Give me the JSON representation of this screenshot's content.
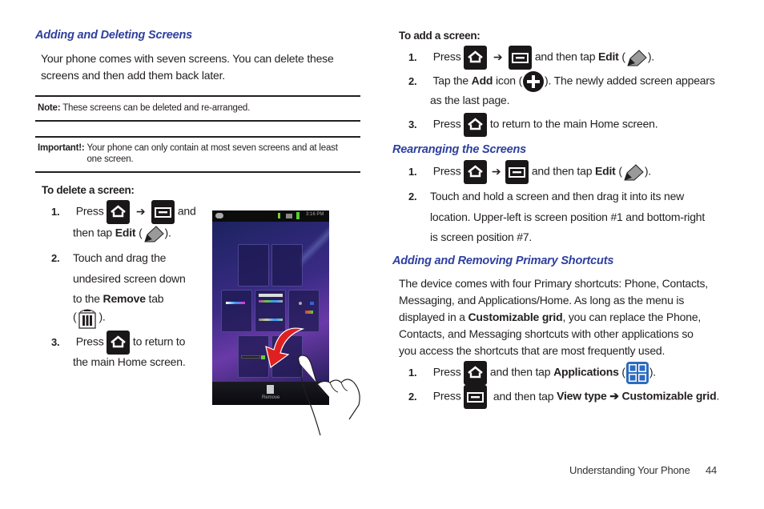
{
  "left_column": {
    "section_title": "Adding and Deleting Screens",
    "intro_lines": [
      "Your phone comes with seven screens. You can delete these",
      "screens and then add them back later."
    ],
    "note": {
      "label": "Note:",
      "text": "These screens can be deleted and re-arranged."
    },
    "important": {
      "label": "Important!:",
      "text_line1": "Your phone can only contain at most seven screens and at least",
      "text_line2": "one screen."
    },
    "delete_heading": "To delete a screen:",
    "delete_steps": [
      {
        "num": "1.",
        "press": "Press",
        "and": "and",
        "then_tap": "then tap",
        "edit": "Edit",
        "open_paren": "(",
        "close_paren": ")."
      },
      {
        "num": "2.",
        "line1": "Touch and drag the",
        "line2": "undesired screen down",
        "line3_pre": "to the",
        "remove": "Remove",
        "line3_post": "tab",
        "open_paren": "(",
        "close_paren": ")."
      },
      {
        "num": "3.",
        "press": "Press",
        "line1_post": "to return to",
        "line2": "the main Home screen."
      }
    ],
    "phone_image": {
      "status_time": "3:16 PM",
      "remove_label": "Remove"
    }
  },
  "right_column": {
    "add_heading": "To add a screen:",
    "add_steps": [
      {
        "num": "1.",
        "press": "Press",
        "then_tap": "and then tap",
        "edit": "Edit",
        "open_paren": "(",
        "close_paren": ")."
      },
      {
        "num": "2.",
        "pre": "Tap the",
        "add": "Add",
        "icon_word": "icon (",
        "post": "). The newly added screen appears",
        "line2": "as the last page."
      },
      {
        "num": "3.",
        "press": "Press",
        "post": "to return to the main Home screen."
      }
    ],
    "rearrange_title": "Rearranging the Screens",
    "rearrange_steps": [
      {
        "num": "1.",
        "press": "Press",
        "then_tap": "and then tap",
        "edit": "Edit",
        "open_paren": "(",
        "close_paren": ")."
      },
      {
        "num": "2.",
        "line1": "Touch and hold a screen and then drag it into its new",
        "line2": "location. Upper-left is screen position #1 and bottom-right",
        "line3": "is screen position #7."
      }
    ],
    "shortcuts_title": "Adding and Removing Primary Shortcuts",
    "shortcuts_para": [
      "The device comes with four Primary shortcuts: Phone, Contacts,",
      "Messaging, and Applications/Home. As long as the menu is",
      {
        "pre": "displayed in a ",
        "bold": "Customizable grid",
        "post": ", you can replace the Phone,"
      },
      "Contacts, and Messaging shortcuts with other applications so",
      "you access the shortcuts that are most frequently used."
    ],
    "shortcuts_para_line3_pre": "displayed in a ",
    "shortcuts_para_line3_bold": "Customizable grid",
    "shortcuts_para_line3_post": ", you can replace the Phone,",
    "shortcut_steps": [
      {
        "num": "1.",
        "press": "Press",
        "then_tap": "and then tap",
        "apps": "Applications",
        "open_paren": "(",
        "close_paren": ")."
      },
      {
        "num": "2.",
        "press": "Press",
        "then_tap": "and then tap",
        "view_type": "View type",
        "arrow": "➔",
        "custom": "Customizable grid",
        "period": "."
      }
    ]
  },
  "arrow_glyph": "➔",
  "footer": {
    "section": "Understanding Your Phone",
    "page": "44"
  },
  "colors": {
    "heading_blue": "#2e3f9e",
    "icon_black": "#1a1718",
    "apps_blue": "#2d6bc0"
  }
}
